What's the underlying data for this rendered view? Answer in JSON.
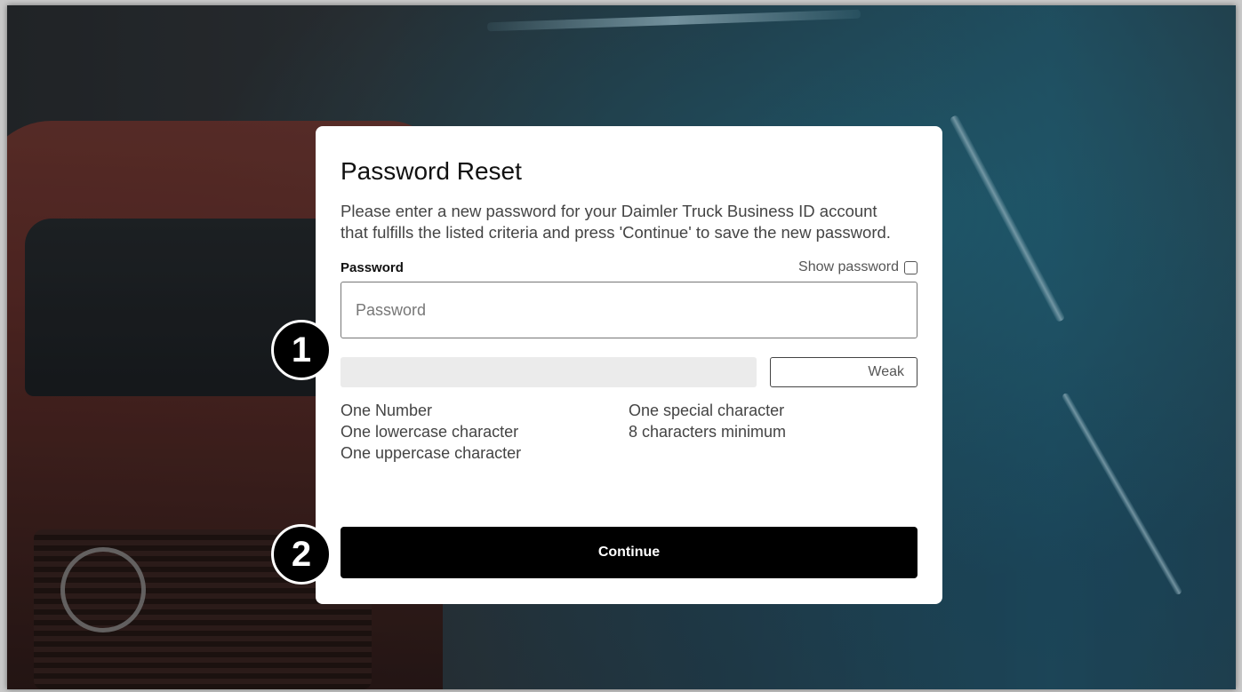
{
  "card": {
    "title": "Password Reset",
    "description": "Please enter a new password for your Daimler Truck Business ID account that fulfills the listed criteria and press 'Continue' to save the new password.",
    "password_label": "Password",
    "show_password_label": "Show password",
    "password_placeholder": "Password",
    "strength_label": "Weak",
    "criteria": [
      "One Number",
      "One special character",
      "One lowercase character",
      "8 characters minimum",
      "One uppercase character"
    ],
    "continue_label": "Continue"
  },
  "markers": {
    "step1": "1",
    "step2": "2"
  }
}
